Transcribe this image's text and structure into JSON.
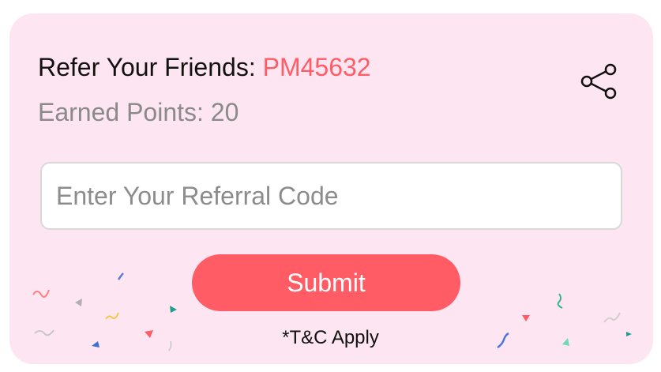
{
  "referral": {
    "label": "Refer Your Friends: ",
    "code": "PM45632"
  },
  "points": {
    "label": "Earned Points: ",
    "value": "20"
  },
  "share": {
    "icon": "share-icon"
  },
  "input": {
    "placeholder": "Enter Your Referral Code",
    "value": ""
  },
  "submit": {
    "label": "Submit"
  },
  "terms": {
    "text": "*T&C Apply"
  },
  "colors": {
    "accent": "#ff5c65",
    "card_background": "#fde6f1",
    "muted_text": "#8a8a8a"
  }
}
